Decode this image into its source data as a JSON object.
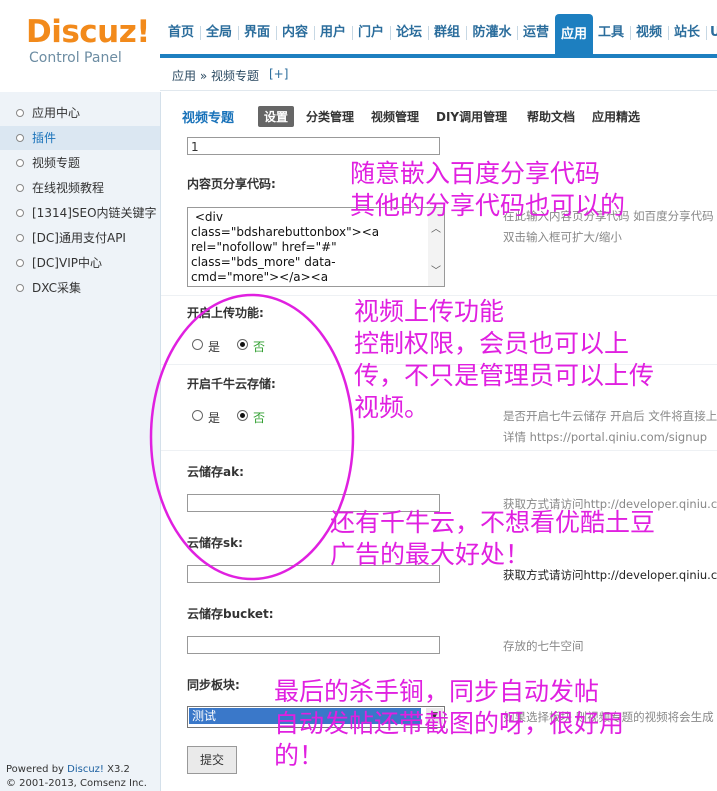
{
  "logo": {
    "brand": "Discuz!",
    "subtitle": "Control Panel"
  },
  "topnav": {
    "items": [
      {
        "label": "首页"
      },
      {
        "label": "全局"
      },
      {
        "label": "界面"
      },
      {
        "label": "内容"
      },
      {
        "label": "用户"
      },
      {
        "label": "门户"
      },
      {
        "label": "论坛"
      },
      {
        "label": "群组"
      },
      {
        "label": "防灌水"
      },
      {
        "label": "运营"
      },
      {
        "label": "应用",
        "active": true
      },
      {
        "label": "工具"
      },
      {
        "label": "视频"
      },
      {
        "label": "站长"
      },
      {
        "label": "U"
      }
    ]
  },
  "breadcrumb": {
    "text": "应用 » 视频专题",
    "add": "[+]"
  },
  "sidebar": {
    "items": [
      {
        "label": "应用中心"
      },
      {
        "label": "插件",
        "active": true
      },
      {
        "label": "视频专题"
      },
      {
        "label": "在线视频教程"
      },
      {
        "label": "[1314]SEO内链关键字"
      },
      {
        "label": "[DC]通用支付API"
      },
      {
        "label": "[DC]VIP中心"
      },
      {
        "label": "DXC采集"
      }
    ],
    "footer": {
      "line1_prefix": "Powered by ",
      "line1_link": "Discuz!",
      "line1_version": " X3.2",
      "line2": "© 2001-2013, Comsenz Inc."
    }
  },
  "subnav": {
    "title": "视频专题",
    "tabs": [
      {
        "label": "设置",
        "active": true
      },
      {
        "label": "分类管理"
      },
      {
        "label": "视频管理"
      },
      {
        "label": "DIY调用管理"
      },
      {
        "label": "帮助文档"
      },
      {
        "label": "应用精选"
      }
    ]
  },
  "form": {
    "top_input_value": "1",
    "share_code": {
      "label": "内容页分享代码:",
      "value": " <div\nclass=\"bdsharebuttonbox\"><a\nrel=\"nofollow\" href=\"#\"\nclass=\"bds_more\" data-\ncmd=\"more\"></a><a\nrel=\"nofollow\" href=\"#\"",
      "tip1": "在此输入内容页分享代码 如百度分享代码",
      "tip2": "双击输入框可扩大/缩小"
    },
    "upload": {
      "label": "开启上传功能:",
      "options": [
        {
          "label": "是",
          "checked": false
        },
        {
          "label": "否",
          "checked": true
        }
      ]
    },
    "qiniu": {
      "label": "开启千牛云存储:",
      "options": [
        {
          "label": "是",
          "checked": false
        },
        {
          "label": "否",
          "checked": true
        }
      ],
      "tip1": "是否开启七牛云储存 开启后 文件将直接上传",
      "tip2": "详情 https://portal.qiniu.com/signup"
    },
    "ak": {
      "label": "云储存ak:",
      "tip": "获取方式请访问http://developer.qiniu.com"
    },
    "sk": {
      "label": "云储存sk:",
      "tip": "获取方式请访问http://developer.qiniu.com"
    },
    "bucket": {
      "label": "云储存bucket:",
      "tip": "存放的七牛空间"
    },
    "sync": {
      "label": "同步板块:",
      "selected": "测试",
      "tip": "如果选择板块 则视频专题的视频将会生成"
    },
    "submit_label": "提交"
  },
  "annotations": {
    "a1_line1": "随意嵌入百度分享代码",
    "a1_line2": "其他的分享代码也可以的",
    "a2_line1": "视频上传功能",
    "a2_line2": "控制权限，会员也可以上",
    "a2_line3": "传，不只是管理员可以上传",
    "a2_line4": "视频。",
    "a3_line1": "还有千牛云，不想看优酷土豆",
    "a3_line2": "广告的最大好处！",
    "a4_line1": "最后的杀手锏，同步自动发帖",
    "a4_line2": "自动发帖还带截图的呀，很好用",
    "a4_line3": "的！",
    "color": "#e020e0"
  },
  "colors": {
    "accent": "#1d7fc0",
    "logo": "#f28a1b",
    "sidebar_bg": "#eef3f8"
  }
}
